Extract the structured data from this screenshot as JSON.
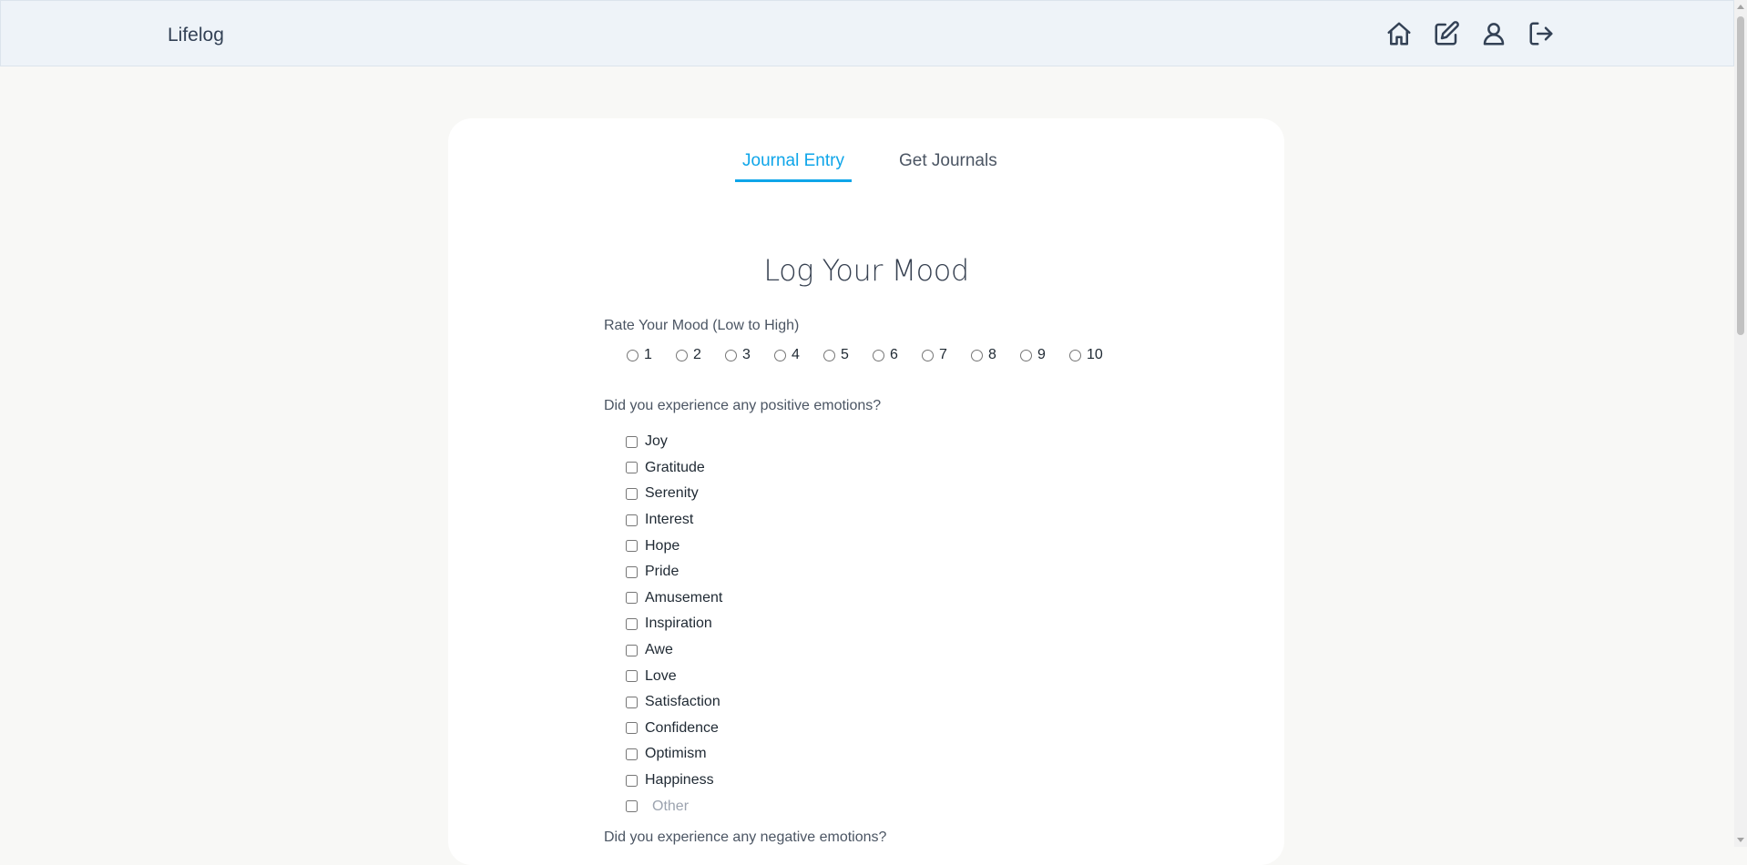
{
  "navbar": {
    "brand": "Lifelog",
    "icons": [
      "home-icon",
      "edit-icon",
      "user-icon",
      "logout-icon"
    ]
  },
  "tabs": {
    "journal_entry": "Journal Entry",
    "get_journals": "Get Journals"
  },
  "form": {
    "title": "Log Your Mood",
    "rate_label": "Rate Your Mood (Low to High)",
    "ratings": [
      "1",
      "2",
      "3",
      "4",
      "5",
      "6",
      "7",
      "8",
      "9",
      "10"
    ],
    "positive_label": "Did you experience any positive emotions?",
    "positive_emotions": [
      "Joy",
      "Gratitude",
      "Serenity",
      "Interest",
      "Hope",
      "Pride",
      "Amusement",
      "Inspiration",
      "Awe",
      "Love",
      "Satisfaction",
      "Confidence",
      "Optimism",
      "Happiness"
    ],
    "other_placeholder": "Other",
    "negative_label": "Did you experience any negative emotions?"
  },
  "colors": {
    "accent": "#0ea5e9",
    "navbar_bg": "#eef3f8",
    "page_bg": "#f8f8f6"
  }
}
